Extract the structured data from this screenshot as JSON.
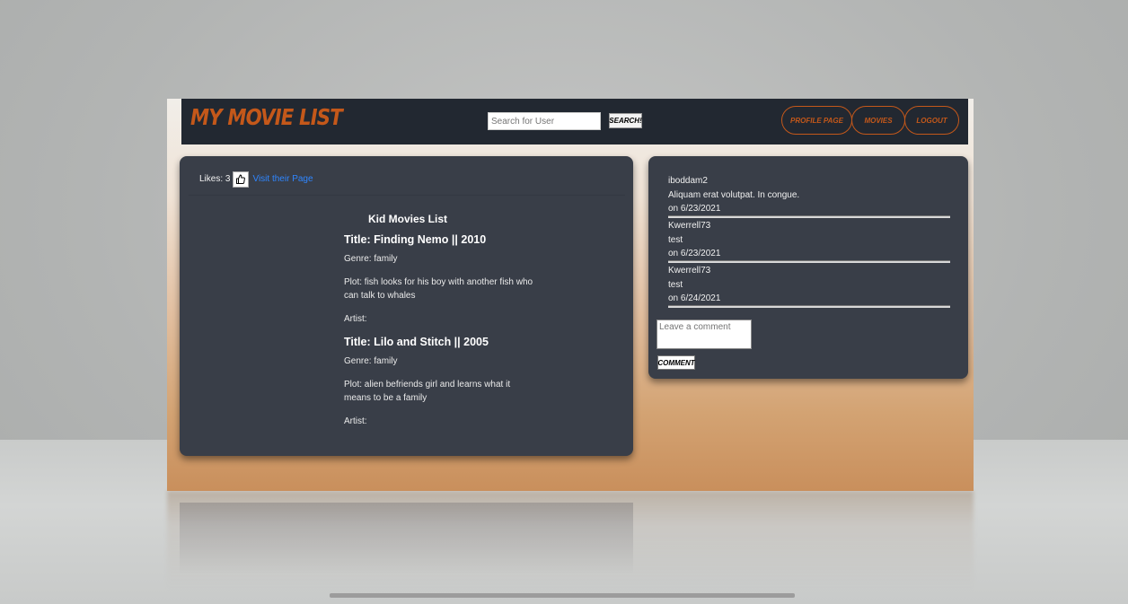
{
  "nav": {
    "brand": "MY MOVIE LIST",
    "search_placeholder": "Search for User",
    "search_button": "SEARCH!",
    "links": [
      "PROFILE PAGE",
      "MOVIES",
      "LOGOUT"
    ]
  },
  "list_card": {
    "likes_label": "Likes: 3",
    "like_icon": "thumbs-up-icon",
    "visit_link": "Visit their Page",
    "list_title": "Kid Movies List",
    "movies": [
      {
        "title": "Title: Finding Nemo || 2010",
        "genre": "Genre: family",
        "plot": "Plot: fish looks for his boy with another fish who can talk to whales",
        "artist": "Artist:"
      },
      {
        "title": "Title: Lilo and Stitch || 2005",
        "genre": "Genre: family",
        "plot": "Plot: alien befriends girl and learns what it means to be a family",
        "artist": "Artist:"
      }
    ]
  },
  "comments_card": {
    "comments": [
      {
        "user": "iboddam2",
        "text": "Aliquam erat volutpat. In congue.",
        "date": "on 6/23/2021"
      },
      {
        "user": "Kwerrell73",
        "text": "test",
        "date": "on 6/23/2021"
      },
      {
        "user": "Kwerrell73",
        "text": "test",
        "date": "on 6/24/2021"
      }
    ],
    "input_placeholder": "Leave a comment",
    "submit_button": "COMMENT"
  },
  "colors": {
    "accent": "#c4581a",
    "navbar": "#222831",
    "card": "#393e48",
    "link": "#2f86ff"
  }
}
